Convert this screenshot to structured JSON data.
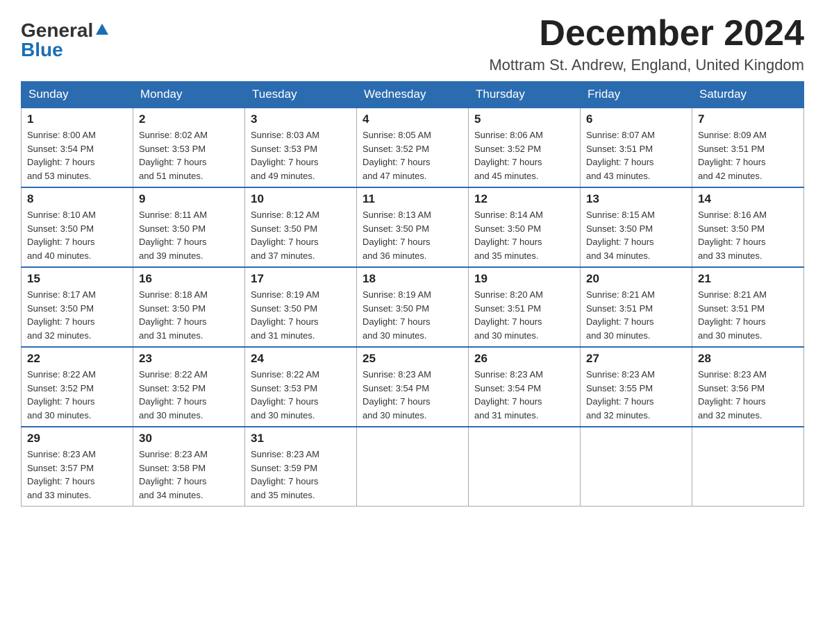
{
  "header": {
    "logo": {
      "general": "General",
      "blue": "Blue",
      "arrow": "▲"
    },
    "title": "December 2024",
    "location": "Mottram St. Andrew, England, United Kingdom"
  },
  "calendar": {
    "columns": [
      "Sunday",
      "Monday",
      "Tuesday",
      "Wednesday",
      "Thursday",
      "Friday",
      "Saturday"
    ],
    "weeks": [
      [
        {
          "day": "1",
          "info": "Sunrise: 8:00 AM\nSunset: 3:54 PM\nDaylight: 7 hours\nand 53 minutes."
        },
        {
          "day": "2",
          "info": "Sunrise: 8:02 AM\nSunset: 3:53 PM\nDaylight: 7 hours\nand 51 minutes."
        },
        {
          "day": "3",
          "info": "Sunrise: 8:03 AM\nSunset: 3:53 PM\nDaylight: 7 hours\nand 49 minutes."
        },
        {
          "day": "4",
          "info": "Sunrise: 8:05 AM\nSunset: 3:52 PM\nDaylight: 7 hours\nand 47 minutes."
        },
        {
          "day": "5",
          "info": "Sunrise: 8:06 AM\nSunset: 3:52 PM\nDaylight: 7 hours\nand 45 minutes."
        },
        {
          "day": "6",
          "info": "Sunrise: 8:07 AM\nSunset: 3:51 PM\nDaylight: 7 hours\nand 43 minutes."
        },
        {
          "day": "7",
          "info": "Sunrise: 8:09 AM\nSunset: 3:51 PM\nDaylight: 7 hours\nand 42 minutes."
        }
      ],
      [
        {
          "day": "8",
          "info": "Sunrise: 8:10 AM\nSunset: 3:50 PM\nDaylight: 7 hours\nand 40 minutes."
        },
        {
          "day": "9",
          "info": "Sunrise: 8:11 AM\nSunset: 3:50 PM\nDaylight: 7 hours\nand 39 minutes."
        },
        {
          "day": "10",
          "info": "Sunrise: 8:12 AM\nSunset: 3:50 PM\nDaylight: 7 hours\nand 37 minutes."
        },
        {
          "day": "11",
          "info": "Sunrise: 8:13 AM\nSunset: 3:50 PM\nDaylight: 7 hours\nand 36 minutes."
        },
        {
          "day": "12",
          "info": "Sunrise: 8:14 AM\nSunset: 3:50 PM\nDaylight: 7 hours\nand 35 minutes."
        },
        {
          "day": "13",
          "info": "Sunrise: 8:15 AM\nSunset: 3:50 PM\nDaylight: 7 hours\nand 34 minutes."
        },
        {
          "day": "14",
          "info": "Sunrise: 8:16 AM\nSunset: 3:50 PM\nDaylight: 7 hours\nand 33 minutes."
        }
      ],
      [
        {
          "day": "15",
          "info": "Sunrise: 8:17 AM\nSunset: 3:50 PM\nDaylight: 7 hours\nand 32 minutes."
        },
        {
          "day": "16",
          "info": "Sunrise: 8:18 AM\nSunset: 3:50 PM\nDaylight: 7 hours\nand 31 minutes."
        },
        {
          "day": "17",
          "info": "Sunrise: 8:19 AM\nSunset: 3:50 PM\nDaylight: 7 hours\nand 31 minutes."
        },
        {
          "day": "18",
          "info": "Sunrise: 8:19 AM\nSunset: 3:50 PM\nDaylight: 7 hours\nand 30 minutes."
        },
        {
          "day": "19",
          "info": "Sunrise: 8:20 AM\nSunset: 3:51 PM\nDaylight: 7 hours\nand 30 minutes."
        },
        {
          "day": "20",
          "info": "Sunrise: 8:21 AM\nSunset: 3:51 PM\nDaylight: 7 hours\nand 30 minutes."
        },
        {
          "day": "21",
          "info": "Sunrise: 8:21 AM\nSunset: 3:51 PM\nDaylight: 7 hours\nand 30 minutes."
        }
      ],
      [
        {
          "day": "22",
          "info": "Sunrise: 8:22 AM\nSunset: 3:52 PM\nDaylight: 7 hours\nand 30 minutes."
        },
        {
          "day": "23",
          "info": "Sunrise: 8:22 AM\nSunset: 3:52 PM\nDaylight: 7 hours\nand 30 minutes."
        },
        {
          "day": "24",
          "info": "Sunrise: 8:22 AM\nSunset: 3:53 PM\nDaylight: 7 hours\nand 30 minutes."
        },
        {
          "day": "25",
          "info": "Sunrise: 8:23 AM\nSunset: 3:54 PM\nDaylight: 7 hours\nand 30 minutes."
        },
        {
          "day": "26",
          "info": "Sunrise: 8:23 AM\nSunset: 3:54 PM\nDaylight: 7 hours\nand 31 minutes."
        },
        {
          "day": "27",
          "info": "Sunrise: 8:23 AM\nSunset: 3:55 PM\nDaylight: 7 hours\nand 32 minutes."
        },
        {
          "day": "28",
          "info": "Sunrise: 8:23 AM\nSunset: 3:56 PM\nDaylight: 7 hours\nand 32 minutes."
        }
      ],
      [
        {
          "day": "29",
          "info": "Sunrise: 8:23 AM\nSunset: 3:57 PM\nDaylight: 7 hours\nand 33 minutes."
        },
        {
          "day": "30",
          "info": "Sunrise: 8:23 AM\nSunset: 3:58 PM\nDaylight: 7 hours\nand 34 minutes."
        },
        {
          "day": "31",
          "info": "Sunrise: 8:23 AM\nSunset: 3:59 PM\nDaylight: 7 hours\nand 35 minutes."
        },
        {
          "day": "",
          "info": ""
        },
        {
          "day": "",
          "info": ""
        },
        {
          "day": "",
          "info": ""
        },
        {
          "day": "",
          "info": ""
        }
      ]
    ]
  }
}
